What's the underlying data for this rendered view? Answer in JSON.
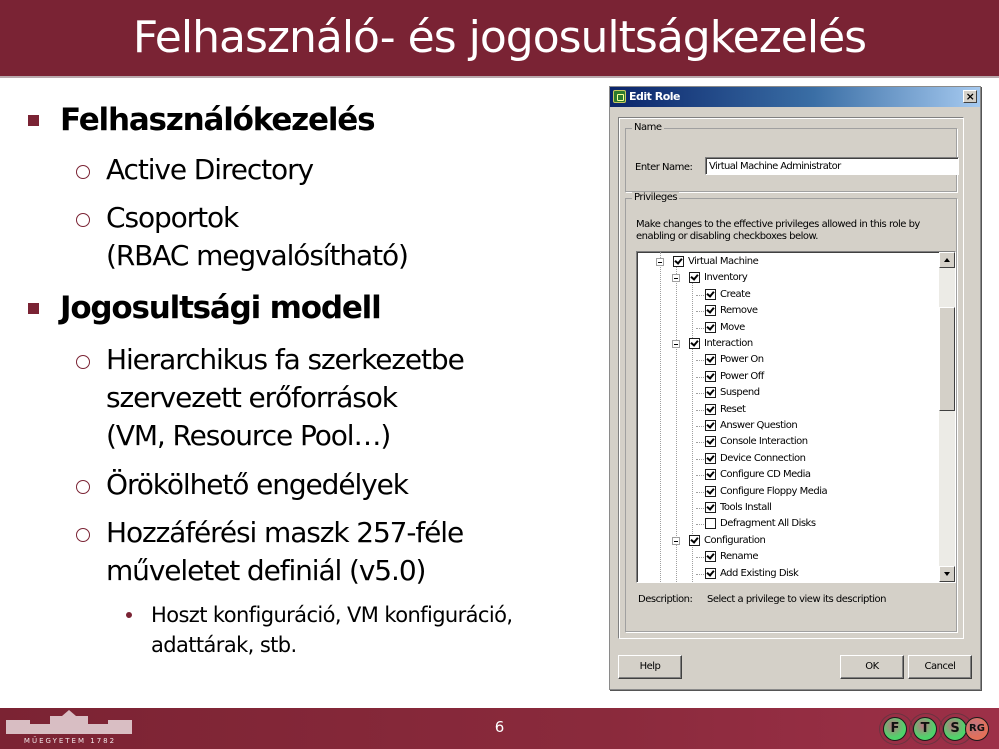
{
  "slide": {
    "title": "Felhasználó- és jogosultságkezelés",
    "page_number": "6",
    "accent_color": "#7a2334"
  },
  "bullets": [
    {
      "level": 1,
      "text": "Felhasználókezelés"
    },
    {
      "level": 2,
      "text": "Active Directory"
    },
    {
      "level": 2,
      "text": "Csoportok"
    },
    {
      "level": 2,
      "continuation": true,
      "text": "(RBAC megvalósítható)"
    },
    {
      "level": 1,
      "text": "Jogosultsági modell"
    },
    {
      "level": 2,
      "text": "Hierarchikus fa szerkezetbe"
    },
    {
      "level": 2,
      "continuation": true,
      "text": "szervezett erőforrások"
    },
    {
      "level": 2,
      "continuation": true,
      "text": "(VM, Resource Pool…)"
    },
    {
      "level": 2,
      "text": "Örökölhető engedélyek"
    },
    {
      "level": 2,
      "text": "Hozzáférési maszk 257-féle"
    },
    {
      "level": 2,
      "continuation": true,
      "text": "műveletet definiál (v5.0)"
    },
    {
      "level": 3,
      "text": "Hoszt konfiguráció, VM konfiguráció,"
    },
    {
      "level": 3,
      "continuation": true,
      "text": "adattárak, stb."
    }
  ],
  "dialog": {
    "title": "Edit Role",
    "close_icon": "×",
    "name_group_label": "Name",
    "enter_name_label": "Enter Name:",
    "enter_name_value": "Virtual Machine Administrator",
    "privileges_group_label": "Privileges",
    "privileges_help": "Make changes to the effective privileges allowed in this role by enabling or disabling checkboxes below.",
    "tree": [
      {
        "label": "Virtual Machine",
        "depth": 0,
        "checked": true,
        "expanded": true
      },
      {
        "label": "Inventory",
        "depth": 1,
        "checked": true,
        "expanded": true
      },
      {
        "label": "Create",
        "depth": 2,
        "checked": true
      },
      {
        "label": "Remove",
        "depth": 2,
        "checked": true
      },
      {
        "label": "Move",
        "depth": 2,
        "checked": true
      },
      {
        "label": "Interaction",
        "depth": 1,
        "checked": true,
        "expanded": true
      },
      {
        "label": "Power On",
        "depth": 2,
        "checked": true
      },
      {
        "label": "Power Off",
        "depth": 2,
        "checked": true
      },
      {
        "label": "Suspend",
        "depth": 2,
        "checked": true
      },
      {
        "label": "Reset",
        "depth": 2,
        "checked": true
      },
      {
        "label": "Answer Question",
        "depth": 2,
        "checked": true
      },
      {
        "label": "Console Interaction",
        "depth": 2,
        "checked": true
      },
      {
        "label": "Device Connection",
        "depth": 2,
        "checked": true
      },
      {
        "label": "Configure CD Media",
        "depth": 2,
        "checked": true
      },
      {
        "label": "Configure Floppy Media",
        "depth": 2,
        "checked": true
      },
      {
        "label": "Tools Install",
        "depth": 2,
        "checked": true
      },
      {
        "label": "Defragment All Disks",
        "depth": 2,
        "checked": false
      },
      {
        "label": "Configuration",
        "depth": 1,
        "checked": true,
        "expanded": true
      },
      {
        "label": "Rename",
        "depth": 2,
        "checked": true
      },
      {
        "label": "Add Existing Disk",
        "depth": 2,
        "checked": true
      }
    ],
    "description_label": "Description:",
    "description_value": "Select a privilege to view its description",
    "buttons": {
      "help": "Help",
      "ok": "OK",
      "cancel": "Cancel"
    }
  },
  "footer": {
    "university_logo_text": "MŰEGYETEM 1782",
    "group_logo_letters": [
      "F",
      "T",
      "S",
      "RG"
    ],
    "group_logo_colors": [
      "#4fd36a",
      "#4fd36a",
      "#4fd36a",
      "#e2705a"
    ]
  }
}
